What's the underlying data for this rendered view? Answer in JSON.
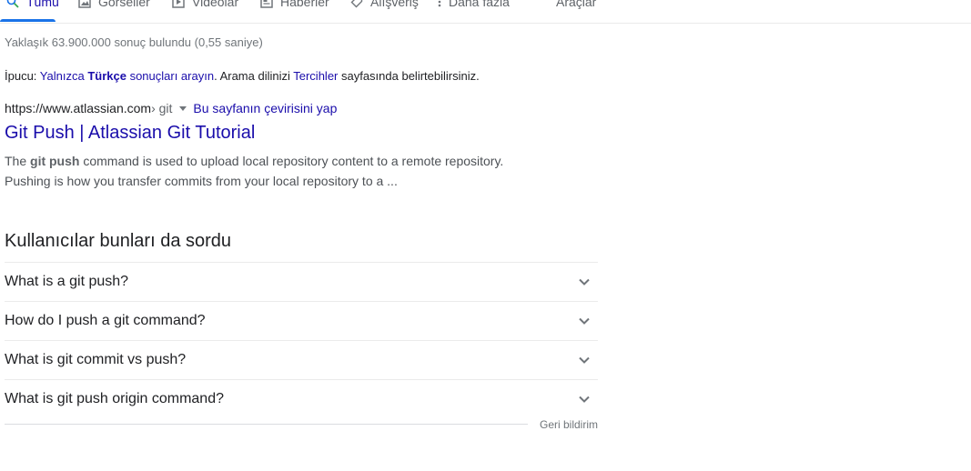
{
  "tabs": [
    {
      "label": "Tümü",
      "icon": "search-icon",
      "active": true
    },
    {
      "label": "Görseller",
      "icon": "image-icon"
    },
    {
      "label": "Videolar",
      "icon": "video-icon"
    },
    {
      "label": "Haberler",
      "icon": "news-icon"
    },
    {
      "label": "Alışveriş",
      "icon": "tag-icon"
    },
    {
      "label": "Daha fazla",
      "icon": "more-vert-icon"
    },
    {
      "label": "Araçlar"
    }
  ],
  "stats": "Yaklaşık 63.900.000 sonuç bulundu (0,55 saniye)",
  "tip": {
    "prefix": "İpucu: ",
    "link1": "Yalnızca ",
    "bold": "Türkçe",
    "link1b": " sonuçları arayın",
    "mid": ". Arama dilinizi ",
    "link2": "Tercihler",
    "suffix": " sayfasında belirtebilirsiniz."
  },
  "result": {
    "url": "https://www.atlassian.com",
    "path": " › git",
    "translate": "Bu sayfanın çevirisini yap",
    "title": "Git Push | Atlassian Git Tutorial",
    "snippet_pre": "The ",
    "snippet_bold": "git push",
    "snippet_line1": " command is used to upload local repository content to a remote repository.",
    "snippet_line2": "Pushing is how you transfer commits from your local repository to a ..."
  },
  "paa": {
    "heading": "Kullanıcılar bunları da sordu",
    "questions": [
      "What is a git push?",
      "How do I push a git command?",
      "What is git commit vs push?",
      "What is git push origin command?"
    ]
  },
  "feedback": "Geri bildirim",
  "colors": {
    "link": "#1a0dab",
    "active_tab": "#1a73e8",
    "muted": "#70757a"
  }
}
